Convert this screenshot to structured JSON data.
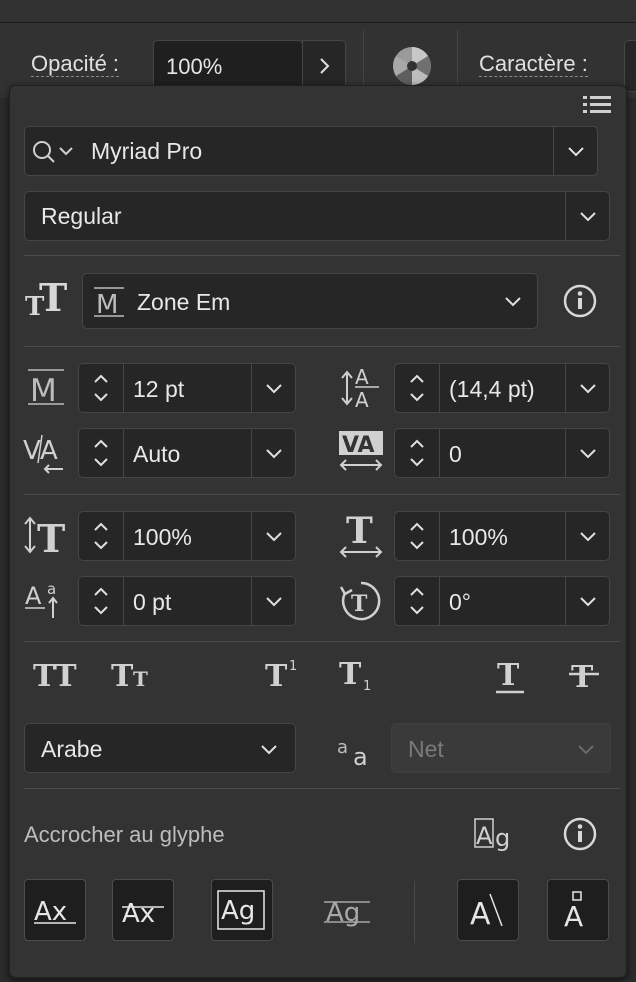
{
  "toolbar": {
    "opacity_label": "Opacité :",
    "opacity_value": "100%",
    "character_label": "Caractère :"
  },
  "panel": {
    "font_family": "Myriad Pro",
    "font_style": "Regular",
    "measure_option": "Zone Em",
    "font_size": "12 pt",
    "leading": "(14,4 pt)",
    "kerning": "Auto",
    "tracking": "0",
    "vertical_scale": "100%",
    "horizontal_scale": "100%",
    "baseline_shift": "0 pt",
    "rotation": "0°",
    "language": "Arabe",
    "antialias": "Net",
    "snap_label": "Accrocher au glyphe"
  },
  "icons": [
    "panel-menu-icon",
    "search-icon",
    "info-icon",
    "font-size-icon",
    "leading-icon",
    "kerning-icon",
    "tracking-icon",
    "vertical-scale-icon",
    "horizontal-scale-icon",
    "baseline-shift-icon",
    "rotation-icon",
    "all-caps-icon",
    "small-caps-icon",
    "superscript-icon",
    "subscript-icon",
    "underline-icon",
    "strikethrough-icon"
  ],
  "colors": {
    "panel_bg": "#333333",
    "field_bg": "#262626",
    "text": "#e6e6e6",
    "disabled": "#7a7a7a"
  }
}
